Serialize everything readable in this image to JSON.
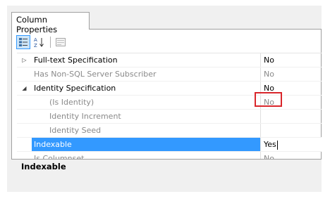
{
  "tab": {
    "label": "Column Properties"
  },
  "toolbar": {
    "buttons": [
      {
        "name": "categorized-icon",
        "active": true
      },
      {
        "name": "alphabetical-sort-icon",
        "active": false
      },
      {
        "name": "property-pages-icon",
        "active": false
      }
    ],
    "alpha_top": "A",
    "alpha_bottom": "Z"
  },
  "properties": [
    {
      "glyph": "▷",
      "name": "Full-text Specification",
      "value": "No",
      "indent": false,
      "grey": false,
      "selected": false
    },
    {
      "glyph": "",
      "name": "Has Non-SQL Server Subscriber",
      "value": "No",
      "indent": false,
      "grey": true,
      "selected": false
    },
    {
      "glyph": "◢",
      "name": "Identity Specification",
      "value": "No",
      "indent": false,
      "grey": false,
      "selected": false
    },
    {
      "glyph": "",
      "name": "(Is Identity)",
      "value": "No",
      "indent": true,
      "grey": true,
      "selected": false
    },
    {
      "glyph": "",
      "name": "Identity Increment",
      "value": "",
      "indent": true,
      "grey": true,
      "selected": false
    },
    {
      "glyph": "",
      "name": "Identity Seed",
      "value": "",
      "indent": true,
      "grey": true,
      "selected": false
    },
    {
      "glyph": "",
      "name": "Indexable",
      "value": "Yes",
      "indent": false,
      "grey": false,
      "selected": true
    },
    {
      "glyph": "",
      "name": "Is Columnset",
      "value": "No",
      "indent": false,
      "grey": true,
      "selected": false
    }
  ],
  "description": {
    "title": "Indexable"
  },
  "colors": {
    "selection": "#3399ff",
    "highlight_border": "#d9262b",
    "disabled_text": "#8a8a8a"
  }
}
